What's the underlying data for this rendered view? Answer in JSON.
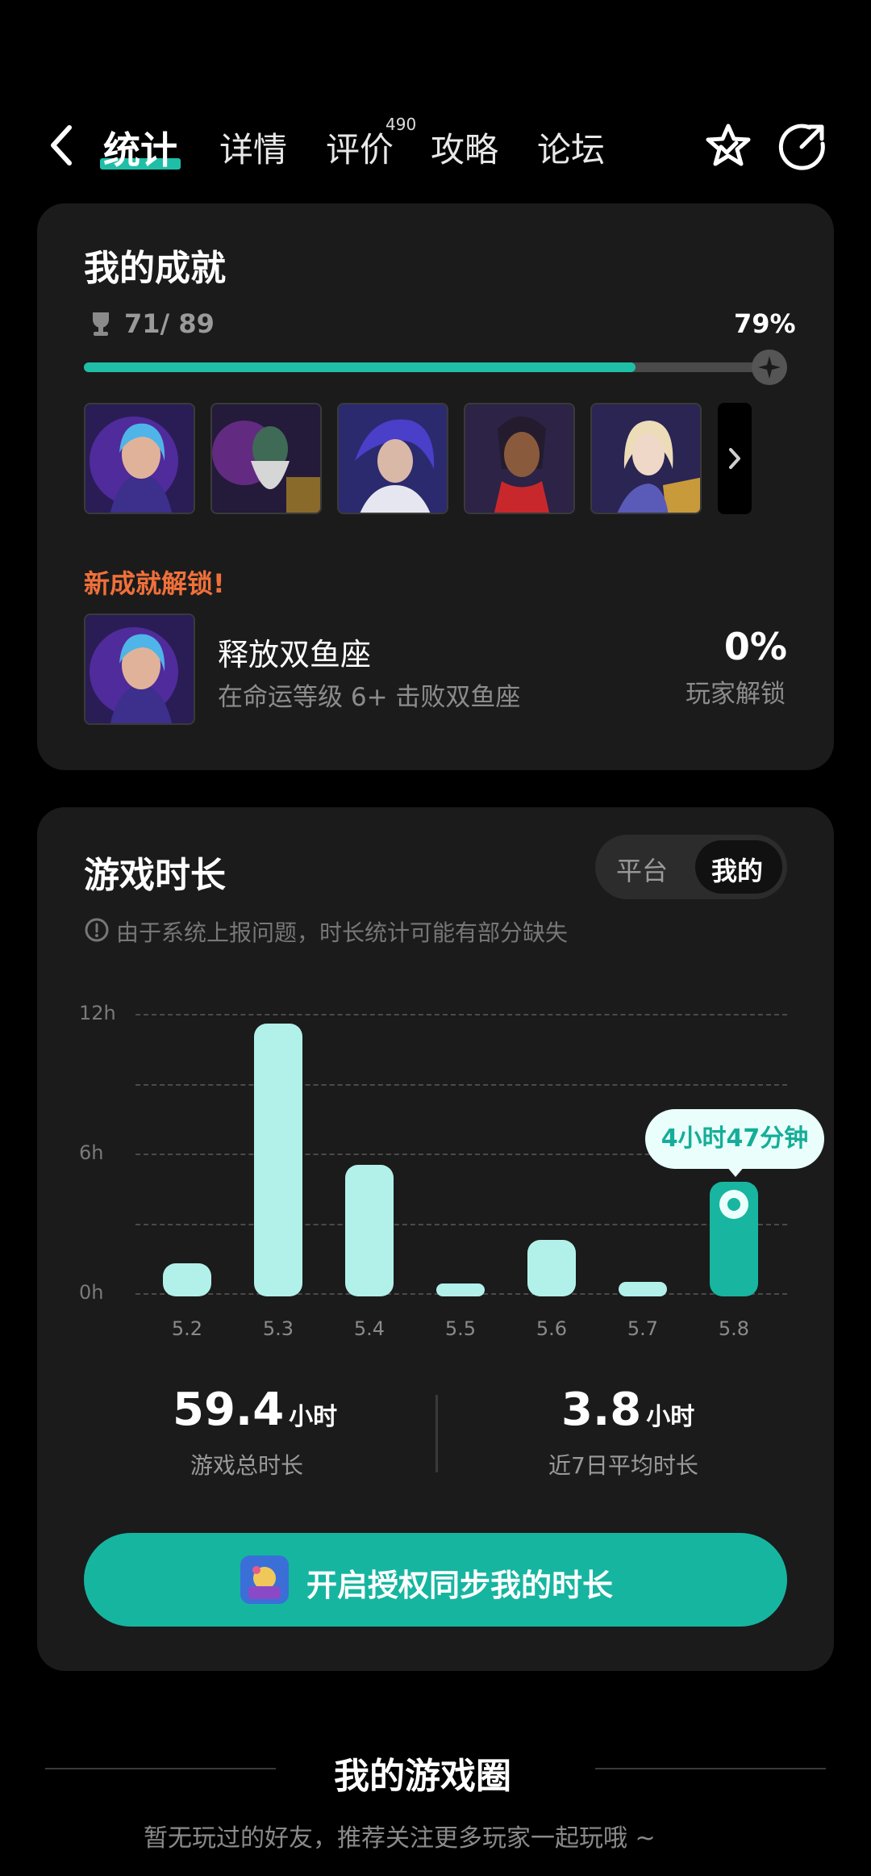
{
  "nav": {
    "tabs": [
      {
        "label": "统计"
      },
      {
        "label": "详情"
      },
      {
        "label": "评价",
        "badge": "490"
      },
      {
        "label": "攻略"
      },
      {
        "label": "论坛"
      }
    ],
    "icons": [
      "back-icon",
      "star-badge-icon",
      "share-icon"
    ]
  },
  "achievements": {
    "title": "我的成就",
    "count": "71/ 89",
    "percent": "79%",
    "progress": 0.79,
    "new_unlock_label": "新成就解锁!",
    "item": {
      "name": "释放双鱼座",
      "desc": "在命运等级 6+ 击败双鱼座",
      "rate": "0%",
      "rate_label": "玩家解锁"
    }
  },
  "playtime": {
    "title": "游戏时长",
    "toggle": {
      "options": [
        "平台",
        "我的"
      ],
      "selected": "我的"
    },
    "notice": "由于系统上报问题，时长统计可能有部分缺失",
    "tooltip": "4小时47分钟",
    "total_value": "59.4",
    "total_unit": "小时",
    "total_label": "游戏总时长",
    "avg_value": "3.8",
    "avg_unit": "小时",
    "avg_label": "近7日平均时长",
    "cta_label": "开启授权同步我的时长"
  },
  "chart_data": {
    "type": "bar",
    "categories": [
      "5.2",
      "5.3",
      "5.4",
      "5.5",
      "5.6",
      "5.7",
      "5.8"
    ],
    "values": [
      1.3,
      11.6,
      5.5,
      0.4,
      2.3,
      0.5,
      4.78
    ],
    "y_ticks": [
      "0h",
      "6h",
      "12h"
    ],
    "ylim": [
      0,
      12
    ],
    "selected_index": 6,
    "grid": true
  },
  "game_circle": {
    "title": "我的游戏圈",
    "empty_text": "暂无玩过的好友，推荐关注更多玩家一起玩哦 ~"
  },
  "colors": {
    "accent": "#1fbfa7",
    "bar": "#b2f1ea",
    "card": "#1b1b1b",
    "warning": "#f0703a"
  }
}
